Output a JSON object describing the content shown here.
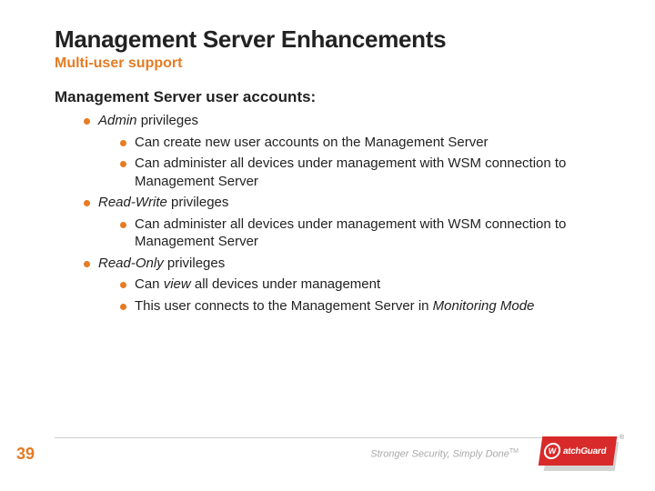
{
  "title": "Management Server Enhancements",
  "subtitle": "Multi-user support",
  "heading": "Management Server user accounts:",
  "priv": {
    "admin": {
      "name": "Admin",
      "suffix": " privileges",
      "b1": "Can create new user accounts on the Management Server",
      "b2": "Can administer all devices under management with WSM connection to Management Server"
    },
    "rw": {
      "name": "Read-Write",
      "suffix": " privileges",
      "b1": "Can administer all devices under management with WSM connection to Management Server"
    },
    "ro": {
      "name": "Read-Only",
      "suffix": " privileges",
      "b1p1": "Can ",
      "b1i": "view",
      "b1p2": " all devices under management",
      "b2p1": "This user connects to the Management Server in ",
      "b2i": "Monitoring Mode"
    }
  },
  "pageNum": "39",
  "tagline": "Stronger Security, Simply Done",
  "tm": "TM",
  "logo": {
    "letter": "W",
    "text": "atchGuard",
    "r": "®"
  }
}
